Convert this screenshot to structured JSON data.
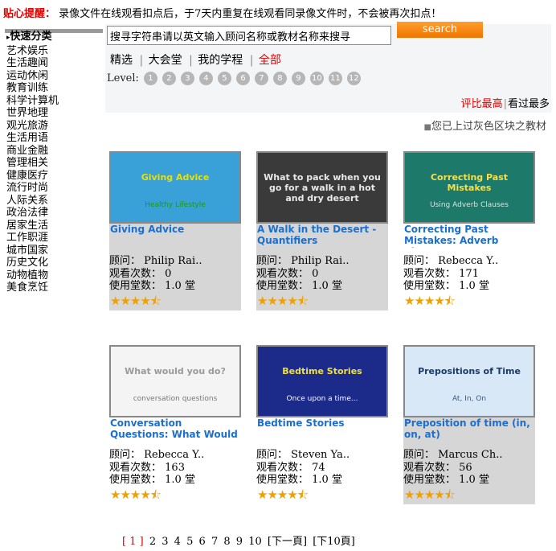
{
  "notice": {
    "label": "贴心提醒：",
    "text": "录像文件在线观看扣点后，于7天内重复在线观看同录像文件时，不会被再次扣点！"
  },
  "sidebar": {
    "heading": "快速分类",
    "items": [
      "艺术娱乐",
      "生活趣闻",
      "运动休闲",
      "教育训练",
      "科学计算机",
      "世界地理",
      "观光旅游",
      "生活用语",
      "商业金融",
      "管理相关",
      "健康医疗",
      "流行时尚",
      "人际关系",
      "政治法律",
      "居家生活",
      "工作职涯",
      "城市国家",
      "历史文化",
      "动物植物",
      "美食烹饪"
    ]
  },
  "search": {
    "value": "搜寻字符串请以英文输入顾问名称或教材名称来搜寻",
    "button": "search"
  },
  "tabs": [
    "精选",
    "大会堂",
    "我的学程",
    "全部"
  ],
  "level": {
    "label": "Level:",
    "numbers": [
      "1",
      "2",
      "3",
      "4",
      "5",
      "6",
      "7",
      "8",
      "9",
      "10",
      "11",
      "12"
    ]
  },
  "sort": {
    "active": "评比最高",
    "other": "看过最多"
  },
  "legend": "您已上过灰色区块之教材",
  "meta_labels": {
    "advisor": "顾问：",
    "views": "观看次数：",
    "credits": "使用堂数："
  },
  "cards": [
    {
      "title": "Giving Advice",
      "slide_title": "Giving Advice",
      "slide_sub": "Healthy Lifestyle",
      "advisor": "Philip Rai..",
      "views": "0",
      "credits": "1.0 堂",
      "stars": "★★★★⯪",
      "colors": {
        "bg": "#3aa0d8",
        "title": "#e8e000",
        "sub": "#1a9a1a"
      }
    },
    {
      "title": "A Walk in the Desert - Quantifiers",
      "slide_title": "What to pack when you go for a walk in a hot and dry desert",
      "slide_sub": "",
      "advisor": "Philip Rai..",
      "views": "0",
      "credits": "1.0 堂",
      "stars": "★★★★⯪",
      "colors": {
        "bg": "#3a3a3a",
        "title": "#e8e8e8",
        "sub": "#d89a4a"
      }
    },
    {
      "title": "Correcting Past Mistakes: Adverb Claus..",
      "slide_title": "Correcting Past Mistakes",
      "slide_sub": "Using Adverb Clauses",
      "advisor": "Rebecca Y..",
      "views": "171",
      "credits": "1.0 堂",
      "stars": "★★★★⯪",
      "colors": {
        "bg": "#1d7a6a",
        "title": "#f4e04a",
        "sub": "#cfe8e0"
      }
    },
    {
      "title": "Conversation Questions: What Would Y..",
      "slide_title": "What would you do?",
      "slide_sub": "conversation questions",
      "advisor": "Rebecca Y..",
      "views": "163",
      "credits": "1.0 堂",
      "stars": "★★★★⯪",
      "colors": {
        "bg": "#f4f4f4",
        "title": "#9a9a9a",
        "sub": "#777777"
      }
    },
    {
      "title": "Bedtime Stories",
      "slide_title": "Bedtime Stories",
      "slide_sub": "Once upon a time...",
      "advisor": "Steven Ya..",
      "views": "74",
      "credits": "1.0 堂",
      "stars": "★★★★⯪",
      "colors": {
        "bg": "#1c2a8a",
        "title": "#f0e040",
        "sub": "#ffffff"
      }
    },
    {
      "title": "Preposition of time (in, on, at)",
      "slide_title": "Prepositions of Time",
      "slide_sub": "At, In, On",
      "advisor": "Marcus Ch..",
      "views": "56",
      "credits": "1.0 堂",
      "stars": "★★★★⯪",
      "colors": {
        "bg": "#d8e8f6",
        "title": "#1a3a6a",
        "sub": "#3a5a8a"
      }
    }
  ],
  "pager": {
    "current": "[ 1 ]",
    "pages": [
      "2",
      "3",
      "4",
      "5",
      "6",
      "7",
      "8",
      "9",
      "10"
    ],
    "next": "[下一頁]",
    "next10": "[下10頁]"
  }
}
